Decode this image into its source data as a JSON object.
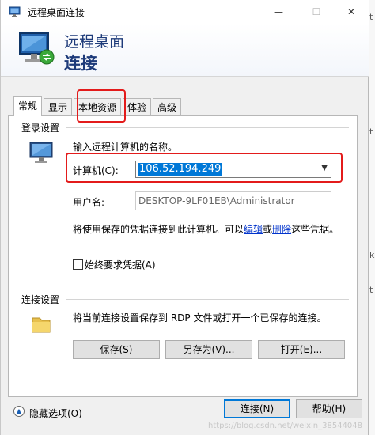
{
  "window": {
    "title": "远程桌面连接",
    "min": "—",
    "max": "☐",
    "close": "✕"
  },
  "banner": {
    "line1": "远程桌面",
    "line2": "连接"
  },
  "tabs": [
    {
      "label": "常规",
      "active": true
    },
    {
      "label": "显示"
    },
    {
      "label": "本地资源"
    },
    {
      "label": "体验"
    },
    {
      "label": "高级"
    }
  ],
  "login": {
    "section_label": "登录设置",
    "prompt": "输入远程计算机的名称。",
    "computer_label": "计算机(C):",
    "computer_value": "106.52.194.249",
    "username_label": "用户名:",
    "username_value": "DESKTOP-9LF01EB\\Administrator",
    "info_prefix": "将使用保存的凭据连接到此计算机。可以",
    "edit_link": "编辑",
    "or": "或",
    "delete_link": "删除",
    "info_suffix": "这些凭据。",
    "always_ask": "始终要求凭据(A)"
  },
  "connection": {
    "section_label": "连接设置",
    "description": "将当前连接设置保存到 RDP 文件或打开一个已保存的连接。",
    "save": "保存(S)",
    "save_as": "另存为(V)...",
    "open": "打开(E)..."
  },
  "footer": {
    "hide_options": "隐藏选项(O)",
    "connect": "连接(N)",
    "help": "帮助(H)"
  },
  "side_strip": [
    "t",
    "t",
    "k",
    "t"
  ],
  "watermark": "https://blog.csdn.net/weixin_38544048"
}
